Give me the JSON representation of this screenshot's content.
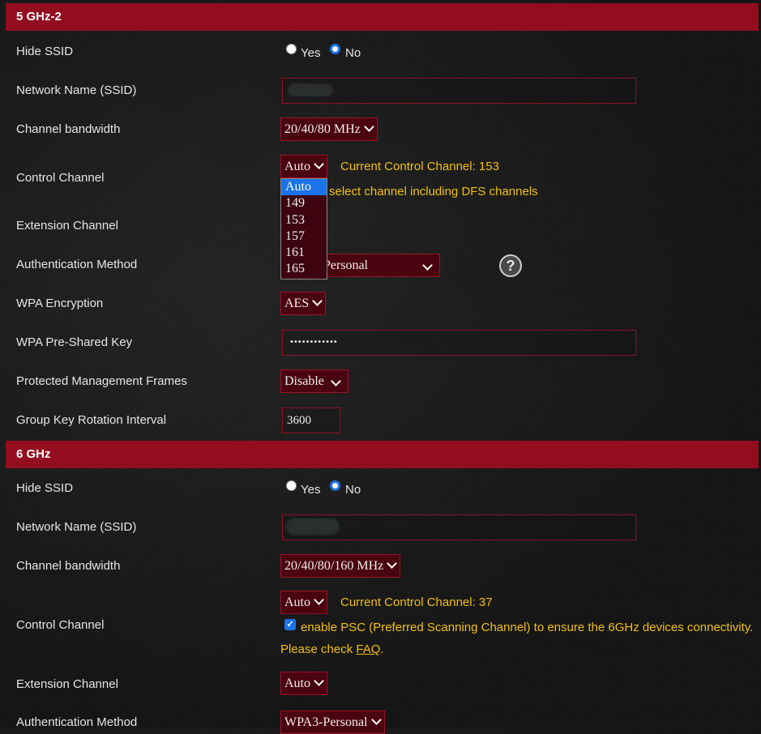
{
  "sections": [
    {
      "title": "5 GHz-2",
      "hide_ssid": {
        "label": "Hide SSID",
        "yes": "Yes",
        "no": "No",
        "selected": "No"
      },
      "ssid": {
        "label": "Network Name (SSID)",
        "value": "(redacted)"
      },
      "bandwidth": {
        "label": "Channel bandwidth",
        "value": "20/40/80 MHz"
      },
      "control_channel": {
        "label": "Control Channel",
        "value": "Auto",
        "current": "Current Control Channel: 153",
        "dfs_text": "Auto select channel including DFS channels",
        "dfs_text_visible": "select channel including DFS channels",
        "options": [
          "Auto",
          "149",
          "153",
          "157",
          "161",
          "165"
        ],
        "highlighted": "Auto"
      },
      "extension_channel": {
        "label": "Extension Channel"
      },
      "auth_method": {
        "label": "Authentication Method",
        "value": "WPA2-Personal",
        "value_visible": "Personal"
      },
      "wpa_encryption": {
        "label": "WPA Encryption",
        "value": "AES"
      },
      "psk": {
        "label": "WPA Pre-Shared Key",
        "value": "••••••••••••"
      },
      "pmf": {
        "label": "Protected Management Frames",
        "value": "Disable"
      },
      "gkri": {
        "label": "Group Key Rotation Interval",
        "value": "3600"
      }
    },
    {
      "title": "6 GHz",
      "hide_ssid": {
        "label": "Hide SSID",
        "yes": "Yes",
        "no": "No",
        "selected": "No"
      },
      "ssid": {
        "label": "Network Name (SSID)",
        "value": "(redacted)"
      },
      "bandwidth": {
        "label": "Channel bandwidth",
        "value": "20/40/80/160 MHz"
      },
      "control_channel": {
        "label": "Control Channel",
        "value": "Auto",
        "current": "Current Control Channel: 37",
        "psc_text": "enable PSC (Preferred Scanning Channel) to ensure the 6GHz devices connectivity.",
        "psc_checked": true,
        "faq_prefix": "Please check ",
        "faq_link": "FAQ",
        "faq_suffix": "."
      },
      "extension_channel": {
        "label": "Extension Channel",
        "value": "Auto"
      },
      "auth_method": {
        "label": "Authentication Method",
        "value": "WPA3-Personal"
      }
    }
  ],
  "icons": {
    "help": "?",
    "checkmark": "✓"
  }
}
